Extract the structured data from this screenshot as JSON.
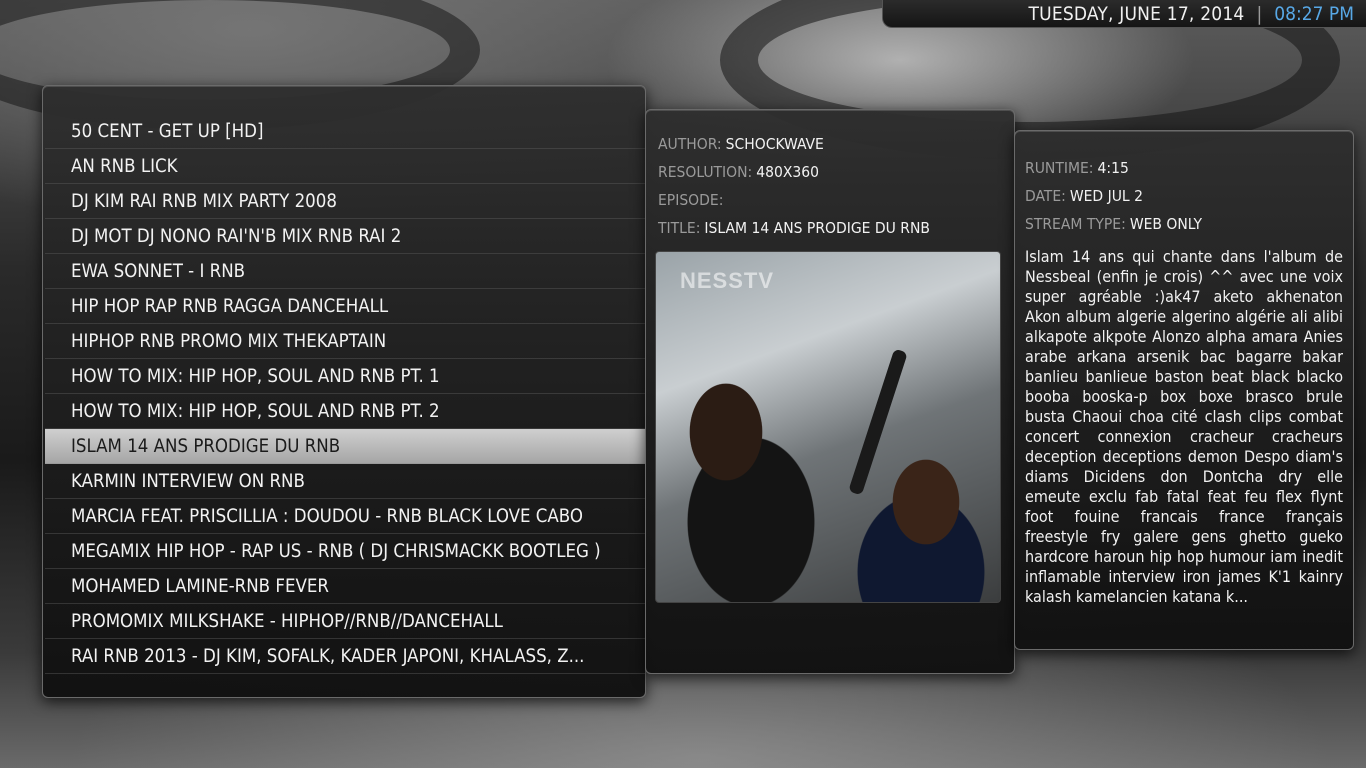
{
  "header": {
    "date": "TUESDAY, JUNE 17, 2014",
    "separator": "|",
    "time": "08:27 PM",
    "time_color": "#58a8e6"
  },
  "list": {
    "selected_index": 9,
    "items": [
      "50 CENT - GET UP [HD]",
      "AN RNB LICK",
      "DJ KIM RAI RNB MIX PARTY 2008",
      "DJ MOT DJ NONO RAI'N'B MIX RNB RAI 2",
      "EWA SONNET - I RNB",
      "HIP HOP RAP RNB RAGGA DANCEHALL",
      "HIPHOP RNB PROMO MIX THEKAPTAIN",
      "HOW TO MIX: HIP HOP, SOUL AND RNB PT. 1",
      "HOW TO MIX: HIP HOP, SOUL AND RNB PT. 2",
      "ISLAM 14 ANS PRODIGE DU RNB",
      "KARMIN INTERVIEW ON RNB",
      "MARCIA FEAT. PRISCILLIA : DOUDOU - RNB BLACK LOVE CABO",
      "MEGAMIX HIP HOP - RAP US - RNB ( DJ CHRISMACKK BOOTLEG )",
      "MOHAMED LAMINE-RNB FEVER",
      "PROMOMIX MILKSHAKE - HIPHOP//RNB//DANCEHALL",
      "RAI RNB 2013 - DJ KIM, SOFALK, KADER JAPONI, KHALASS, Z..."
    ]
  },
  "details": {
    "author_label": "AUTHOR:",
    "author": "SCHOCKWAVE",
    "resolution_label": "RESOLUTION:",
    "resolution": "480X360",
    "episode_label": "EPISODE:",
    "episode": "",
    "title_label": "TITLE:",
    "title": "ISLAM 14 ANS PRODIGE DU RNB",
    "thumbnail_logo": "NESSTV",
    "runtime_label": "RUNTIME:",
    "runtime": "4:15",
    "date_label": "DATE:",
    "date": "WED JUL 2",
    "stream_label": "STREAM TYPE:",
    "stream": "WEB ONLY",
    "description": "Islam 14 ans qui chante dans l'album de Nessbeal (enfin je crois) ^^ avec une voix super agréable :)ak47 aketo akhenaton Akon album algerie algerino algérie ali alibi alkapote alkpote Alonzo alpha amara Anies arabe arkana arsenik bac bagarre bakar banlieu banlieue baston beat black blacko booba booska-p box boxe brasco brule busta Chaoui choa cité clash clips combat concert connexion cracheur cracheurs deception deceptions demon Despo diam's diams Dicidens don Dontcha dry elle emeute exclu fab fatal feat feu flex flynt foot fouine francais france français freestyle fry galere gens ghetto gueko hardcore haroun hip hop humour iam inedit inflamable interview iron james K'1 kainry kalash kamelancien katana k..."
  }
}
